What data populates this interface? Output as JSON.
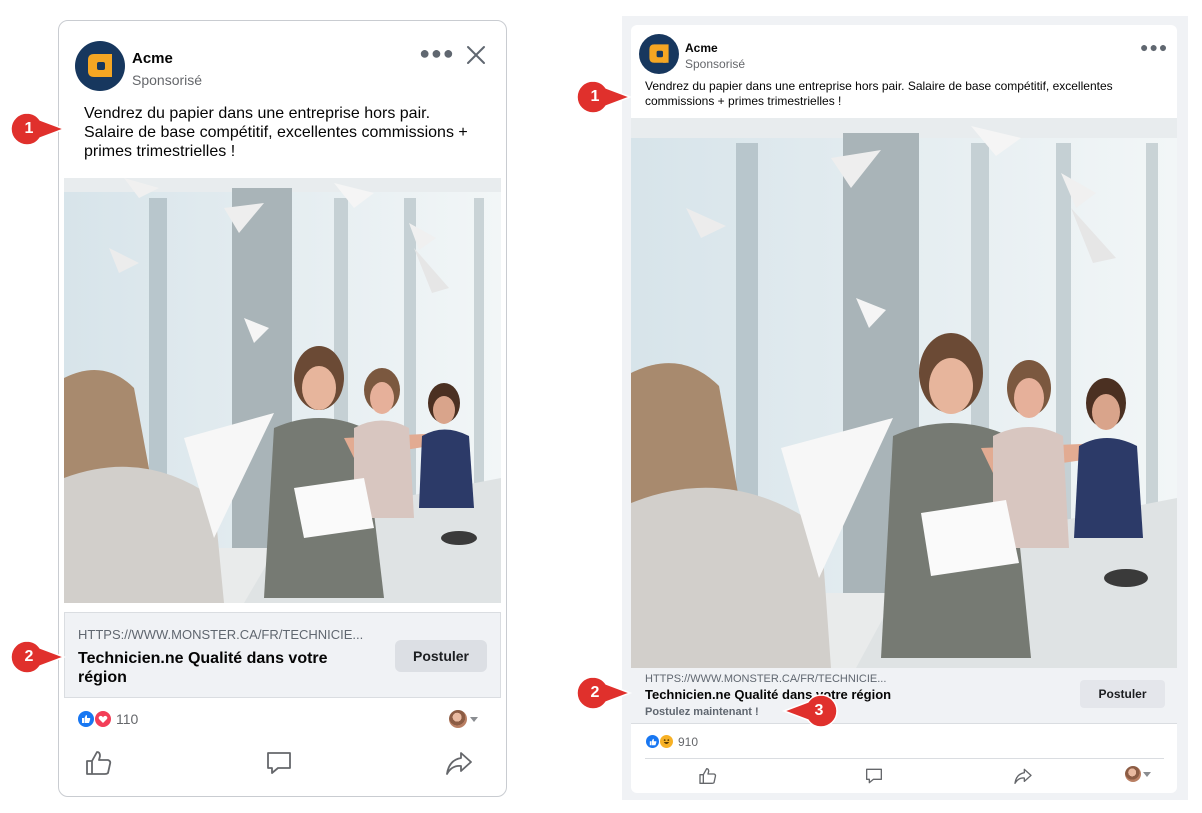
{
  "left_ad": {
    "brand": "Acme",
    "sponsored": "Sponsorisé",
    "more_icon": "ellipsis-icon",
    "close_icon": "close-icon",
    "body_text": "Vendrez du papier dans une entreprise hors pair. Salaire de base compétitif, excellentes commissions + primes trimestrielles !",
    "link_url": "HTTPS://WWW.MONSTER.CA/FR/TECHNICIE...",
    "link_title": "Technicien.ne Qualité dans votre région",
    "cta_label": "Postuler",
    "reaction_count": "110",
    "actions": [
      "like-icon",
      "comment-icon",
      "share-icon"
    ]
  },
  "right_ad": {
    "brand": "Acme",
    "sponsored": "Sponsorisé",
    "more_icon": "ellipsis-icon",
    "body_text": "Vendrez du papier dans une entreprise hors pair. Salaire de base compétitif, excellentes commissions + primes trimestrielles !",
    "link_url": "HTTPS://WWW.MONSTER.CA/FR/TECHNICIE...",
    "link_title": "Technicien.ne Qualité dans votre région",
    "link_subtitle": "Postulez maintenant !",
    "cta_label": "Postuler",
    "reaction_count": "910",
    "actions": [
      "like-icon",
      "comment-icon",
      "share-icon"
    ]
  },
  "callouts": {
    "left_1": "1",
    "left_2": "2",
    "right_1": "1",
    "right_2": "2",
    "right_3": "3"
  },
  "colors": {
    "callout_red": "#e0302c",
    "logo_navy": "#17375e",
    "logo_orange": "#f5a623",
    "like_blue": "#1877f2",
    "love_red": "#f33e58",
    "link_bg": "#f0f2f5"
  }
}
